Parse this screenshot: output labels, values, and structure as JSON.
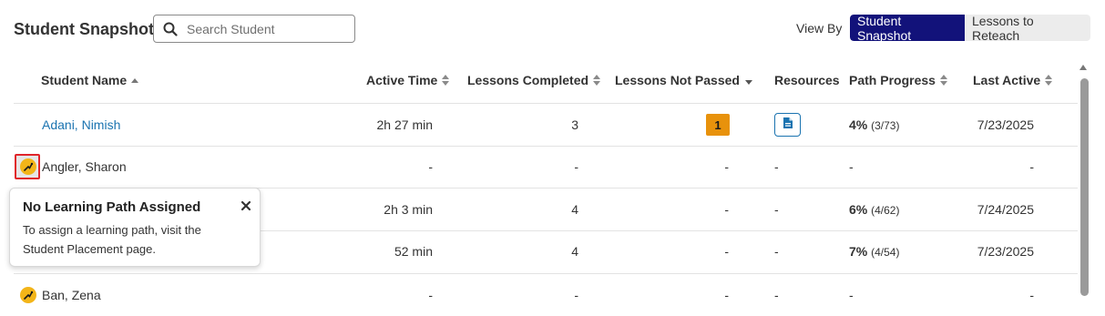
{
  "header": {
    "title": "Student Snapshot",
    "search_placeholder": "Search Student",
    "view_by_label": "View By",
    "view_options": [
      "Student Snapshot",
      "Lessons to Reteach"
    ],
    "active_view": "Student Snapshot"
  },
  "columns": {
    "student_name": "Student Name",
    "active_time": "Active Time",
    "lessons_completed": "Lessons Completed",
    "lessons_not_passed": "Lessons Not Passed",
    "resources": "Resources",
    "path_progress": "Path Progress",
    "last_active": "Last Active"
  },
  "rows": [
    {
      "name": "Adani, Nimish",
      "active_time": "2h 27 min",
      "completed": "3",
      "not_passed": "1",
      "resources": "document-icon",
      "progress_pct": "4%",
      "progress_detail": "(3/73)",
      "last_active": "7/23/2025"
    },
    {
      "name": "Angler, Sharon",
      "active_time": "-",
      "completed": "-",
      "not_passed": "-",
      "resources": "-",
      "progress_pct": "-",
      "progress_detail": "",
      "last_active": "-"
    },
    {
      "name": "",
      "active_time": "2h 3 min",
      "completed": "4",
      "not_passed": "-",
      "resources": "-",
      "progress_pct": "6%",
      "progress_detail": "(4/62)",
      "last_active": "7/24/2025"
    },
    {
      "name": "",
      "active_time": "52 min",
      "completed": "4",
      "not_passed": "-",
      "resources": "-",
      "progress_pct": "7%",
      "progress_detail": "(4/54)",
      "last_active": "7/23/2025"
    },
    {
      "name": "Ban, Zena",
      "active_time": "-",
      "completed": "-",
      "not_passed": "-",
      "resources": "-",
      "progress_pct": "-",
      "progress_detail": "",
      "last_active": "-"
    }
  ],
  "tooltip": {
    "title": "No Learning Path Assigned",
    "body": "To assign a learning path, visit the Student Placement page."
  },
  "colors": {
    "accent_navy": "#12127a",
    "link_blue": "#1a73b0",
    "badge_orange": "#e8920c",
    "no_path_yellow": "#f3b519",
    "highlight_red": "#e0242a"
  }
}
